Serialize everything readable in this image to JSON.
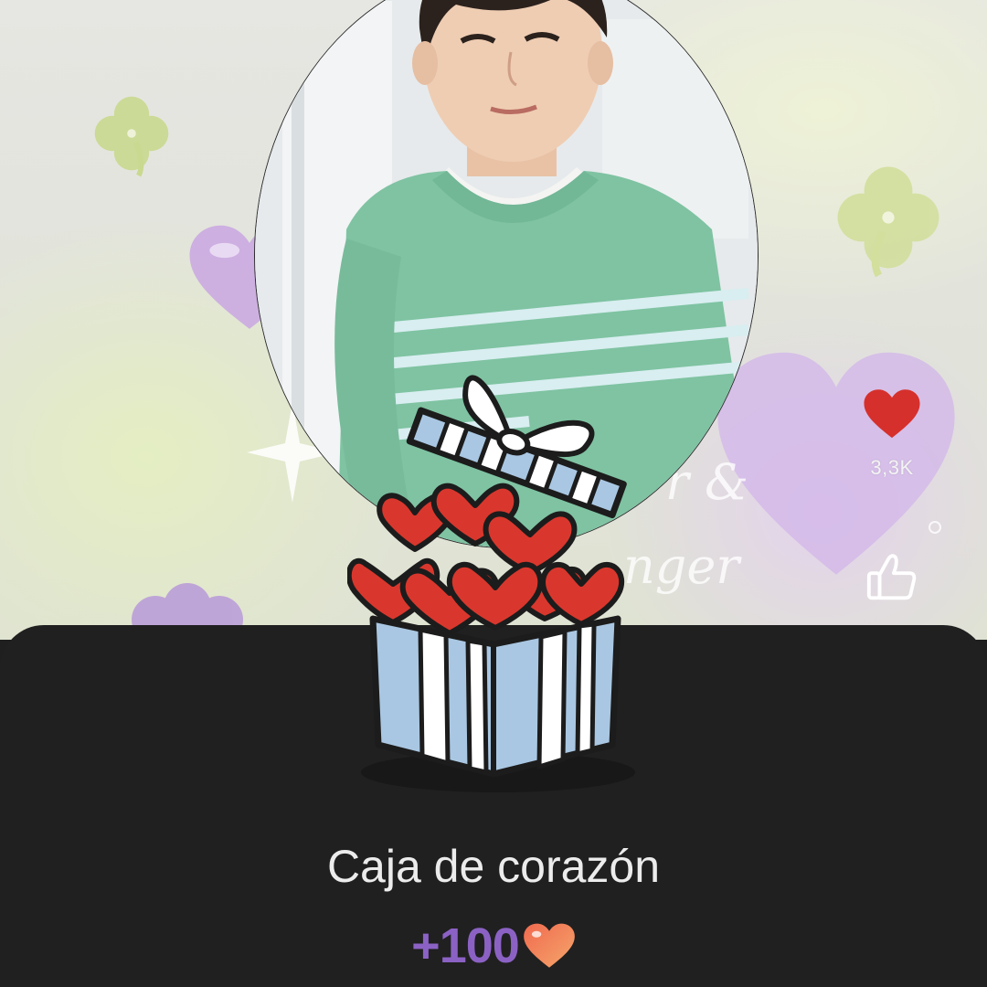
{
  "video": {
    "like_count": "3,3K",
    "background_text_1": "r &",
    "background_text_2": "nger"
  },
  "icons": {
    "like": "heart-icon",
    "thumb": "thumbs-up-icon",
    "gift": "gift-box-hearts-icon",
    "reward": "heart-icon"
  },
  "gift_popup": {
    "title": "Caja de corazón",
    "reward_amount": "+100"
  },
  "colors": {
    "like_heart": "#d6302c",
    "reward_text": "#8b62c4",
    "sheet_background": "#202020",
    "title_text": "#ececec"
  }
}
